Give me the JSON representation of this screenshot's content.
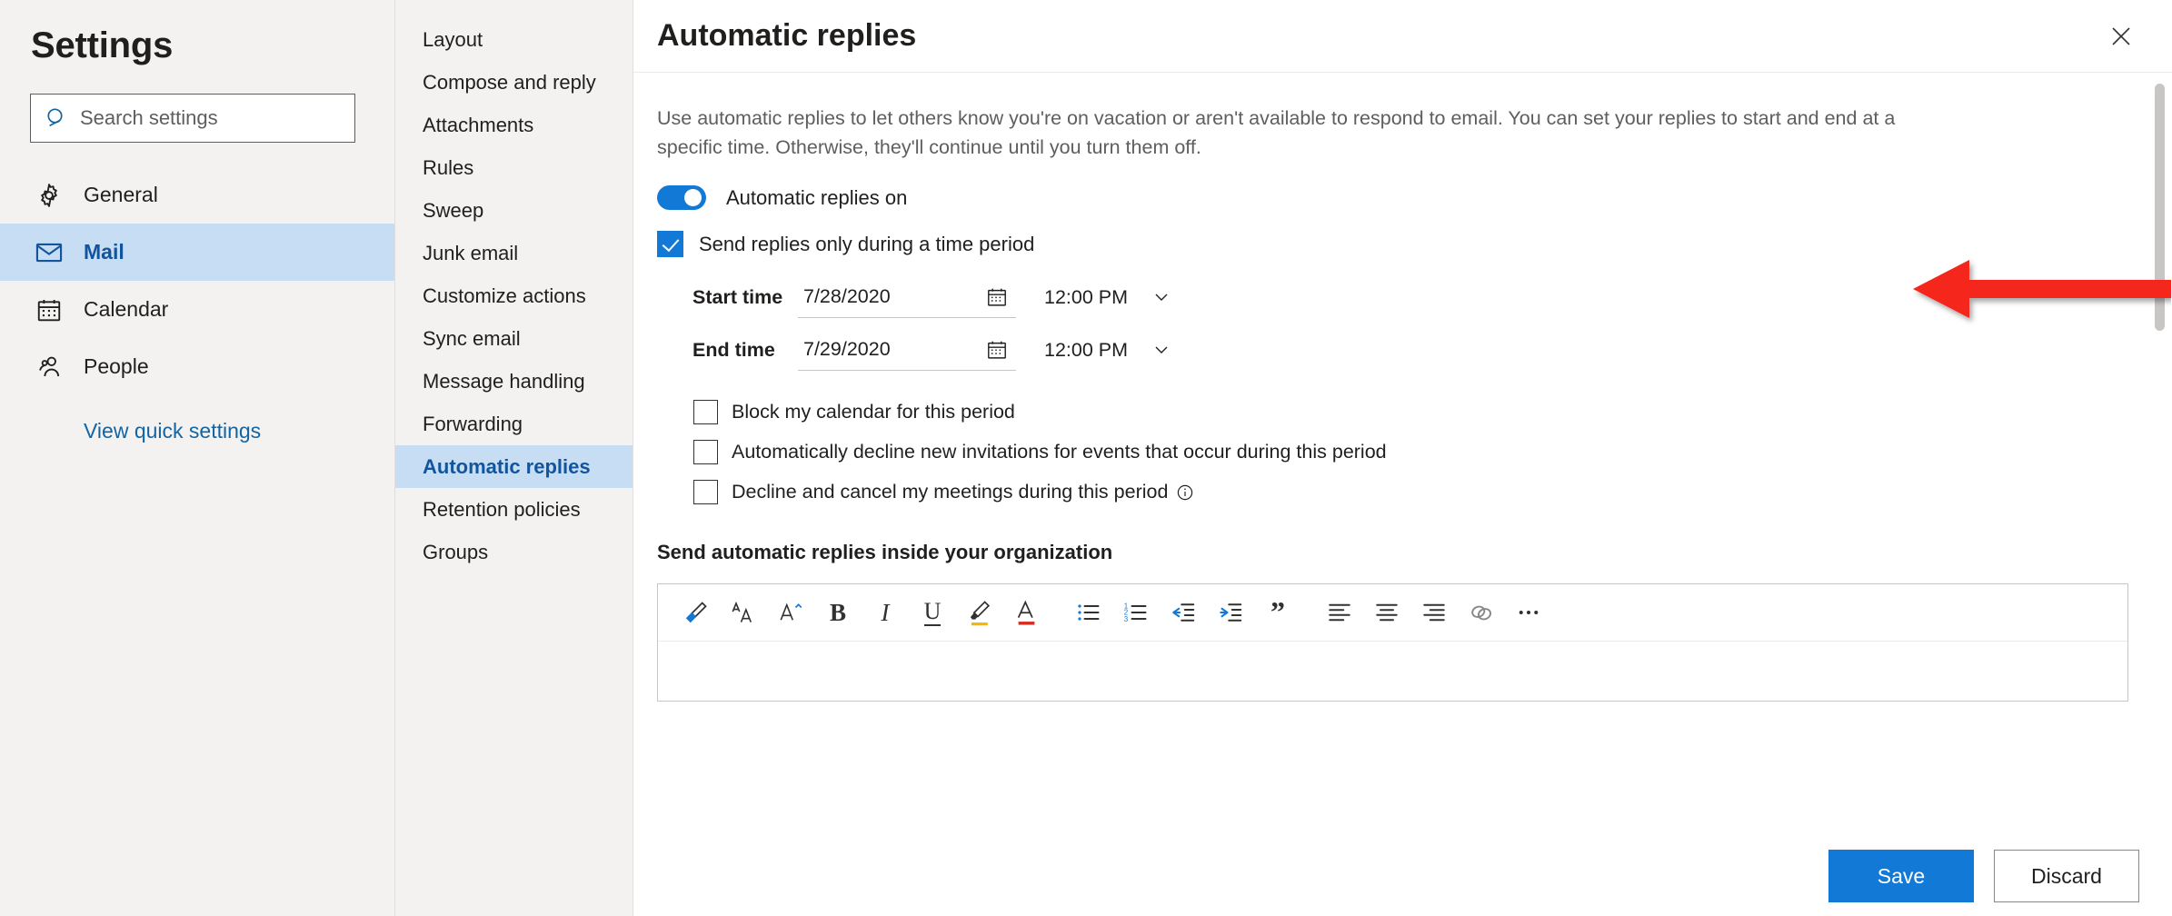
{
  "sidebar": {
    "title": "Settings",
    "search": {
      "placeholder": "Search settings",
      "value": "",
      "icon": "search-icon"
    },
    "items": [
      {
        "label": "General",
        "icon": "gear-icon",
        "selected": false
      },
      {
        "label": "Mail",
        "icon": "envelope-icon",
        "selected": true
      },
      {
        "label": "Calendar",
        "icon": "calendar-icon",
        "selected": false
      },
      {
        "label": "People",
        "icon": "people-icon",
        "selected": false
      }
    ],
    "quick_settings_link": "View quick settings"
  },
  "subnav": {
    "items": [
      {
        "label": "Layout",
        "selected": false
      },
      {
        "label": "Compose and reply",
        "selected": false
      },
      {
        "label": "Attachments",
        "selected": false
      },
      {
        "label": "Rules",
        "selected": false
      },
      {
        "label": "Sweep",
        "selected": false
      },
      {
        "label": "Junk email",
        "selected": false
      },
      {
        "label": "Customize actions",
        "selected": false
      },
      {
        "label": "Sync email",
        "selected": false
      },
      {
        "label": "Message handling",
        "selected": false
      },
      {
        "label": "Forwarding",
        "selected": false
      },
      {
        "label": "Automatic replies",
        "selected": true
      },
      {
        "label": "Retention policies",
        "selected": false
      },
      {
        "label": "Groups",
        "selected": false
      }
    ]
  },
  "main": {
    "title": "Automatic replies",
    "close_icon": "close-icon",
    "description": "Use automatic replies to let others know you're on vacation or aren't available to respond to email. You can set your replies to start and end at a specific time. Otherwise, they'll continue until you turn them off.",
    "toggle": {
      "label": "Automatic replies on",
      "on": true,
      "accent_color": "#1379d6"
    },
    "time_period_checkbox": {
      "label": "Send replies only during a time period",
      "checked": true
    },
    "start_time": {
      "label": "Start time",
      "date": "7/28/2020",
      "time": "12:00 PM",
      "calendar_icon": "calendar-icon",
      "chevron_icon": "chevron-down-icon"
    },
    "end_time": {
      "label": "End time",
      "date": "7/29/2020",
      "time": "12:00 PM",
      "calendar_icon": "calendar-icon",
      "chevron_icon": "chevron-down-icon"
    },
    "options": [
      {
        "label": "Block my calendar for this period",
        "checked": false,
        "info": false
      },
      {
        "label": "Automatically decline new invitations for events that occur during this period",
        "checked": false,
        "info": false
      },
      {
        "label": "Decline and cancel my meetings during this period",
        "checked": false,
        "info": true
      }
    ],
    "section_heading": "Send automatic replies inside your organization",
    "toolbar": [
      {
        "name": "format-painter-icon"
      },
      {
        "name": "font-size-icon"
      },
      {
        "name": "font-grow-icon"
      },
      {
        "name": "bold-icon"
      },
      {
        "name": "italic-icon"
      },
      {
        "name": "underline-icon"
      },
      {
        "name": "highlight-icon"
      },
      {
        "name": "font-color-icon"
      },
      {
        "name": "bulleted-list-icon"
      },
      {
        "name": "numbered-list-icon"
      },
      {
        "name": "decrease-indent-icon"
      },
      {
        "name": "increase-indent-icon"
      },
      {
        "name": "quote-icon"
      },
      {
        "name": "align-left-icon"
      },
      {
        "name": "align-center-icon"
      },
      {
        "name": "align-right-icon"
      },
      {
        "name": "link-icon"
      },
      {
        "name": "more-options-icon"
      }
    ],
    "editor_body": ""
  },
  "footer": {
    "save_label": "Save",
    "discard_label": "Discard",
    "primary_color": "#1379d6"
  },
  "annotation": {
    "type": "arrow",
    "direction": "left",
    "color": "#f5251a",
    "points_to": "Send replies only during a time period"
  }
}
